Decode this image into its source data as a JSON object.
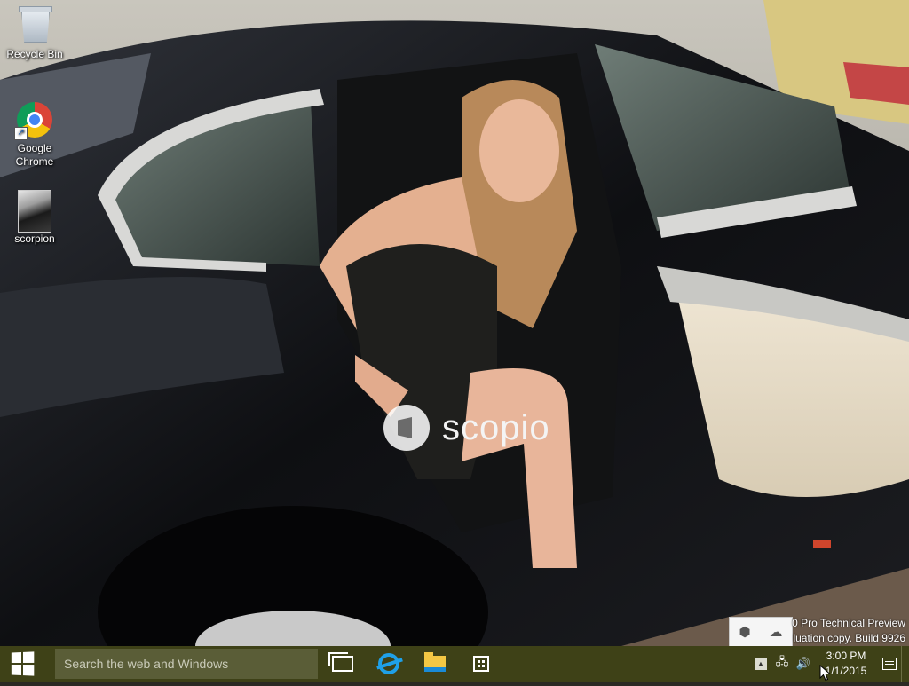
{
  "desktop": {
    "icons": [
      {
        "label": "Recycle Bin",
        "icon": "recycle-bin-icon"
      },
      {
        "label": "Google Chrome",
        "icon": "chrome-icon"
      },
      {
        "label": "scorpion",
        "icon": "image-file-icon"
      }
    ]
  },
  "wallpaper": {
    "watermark_text": "scopio"
  },
  "build_info": {
    "line1": "0 Pro Technical Preview",
    "line2": "luation copy. Build 9926"
  },
  "taskbar": {
    "start_icon": "windows-logo-icon",
    "search_placeholder": "Search the web and Windows",
    "pinned": [
      {
        "name": "Task View",
        "icon": "task-view-icon"
      },
      {
        "name": "Internet Explorer",
        "icon": "internet-explorer-icon"
      },
      {
        "name": "File Explorer",
        "icon": "file-explorer-icon"
      },
      {
        "name": "Store",
        "icon": "store-icon"
      }
    ],
    "tray": {
      "overflow_icon": "chevron-up-icon",
      "network_icon": "network-icon",
      "volume_icon": "volume-icon",
      "notification_icon": "action-center-icon",
      "time": "3:00 PM",
      "date": "1/1/2015"
    },
    "colors": {
      "taskbar": "#3e4117",
      "search_box": "#5a5d37"
    }
  }
}
